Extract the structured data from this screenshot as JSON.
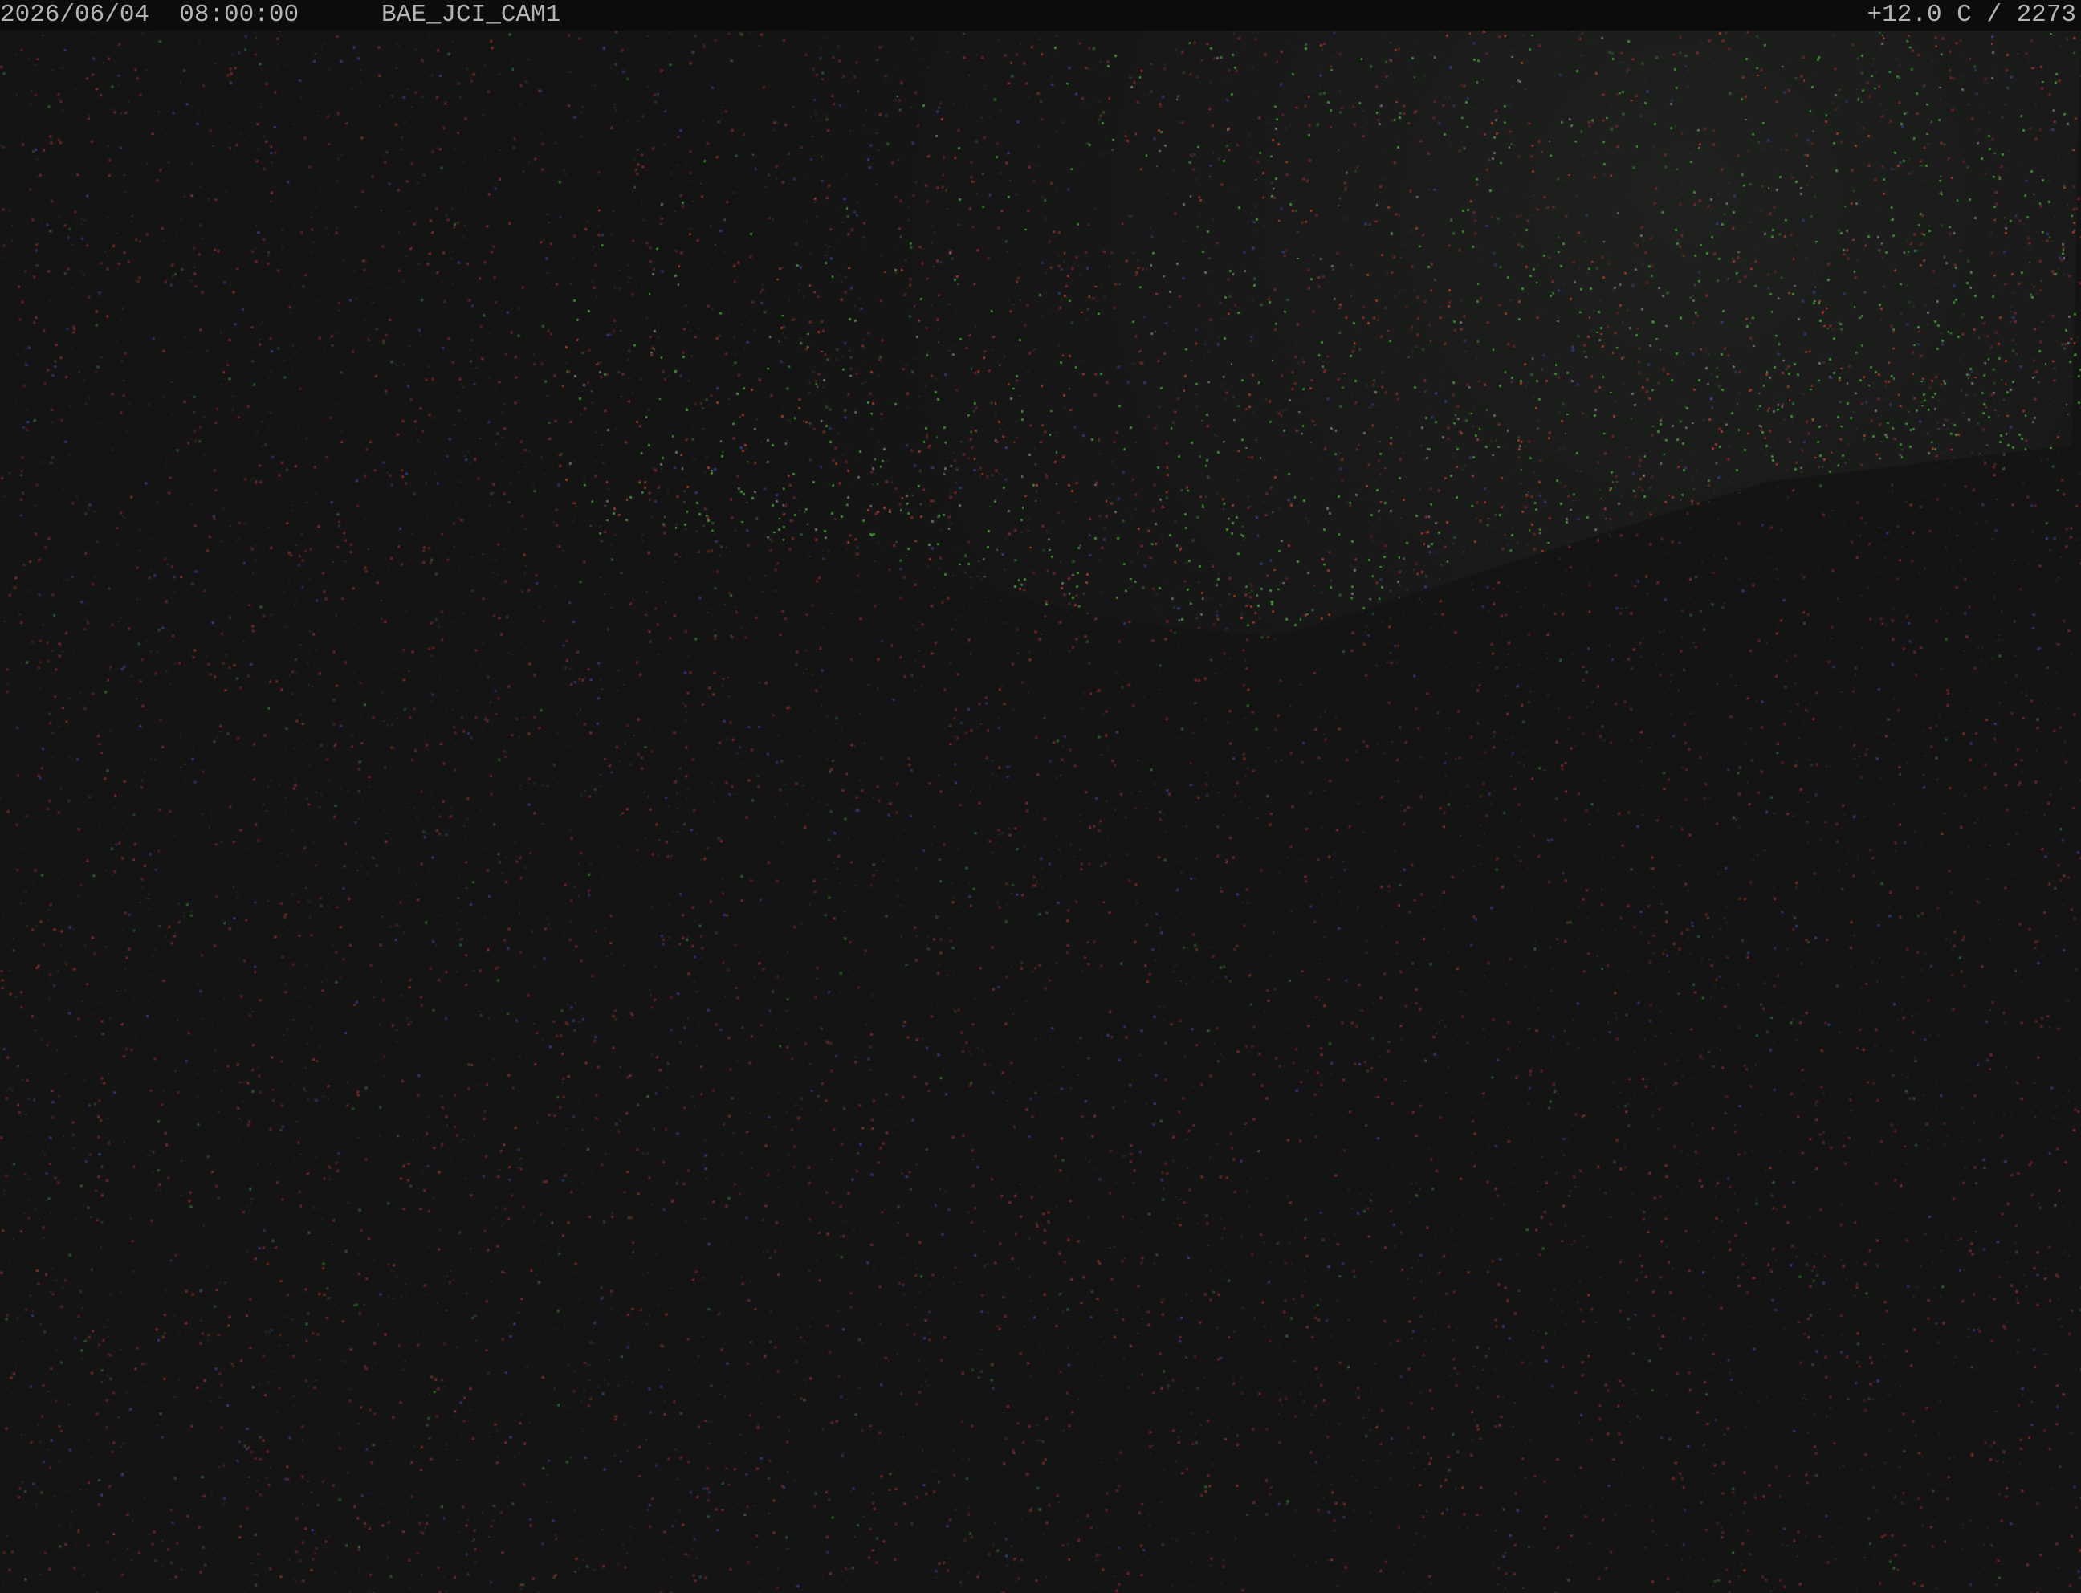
{
  "overlay": {
    "timestamp": "2026/06/04  08:00:00",
    "camera_id": "BAE_JCI_CAM1",
    "temperature_readout": "+12.0 C / 2273"
  },
  "colors": {
    "background": "#141414",
    "overlay_bar": "#0c0c0c",
    "overlay_text": "#b4b4b4",
    "noise_red": "#c03030",
    "noise_green": "#3aa03a",
    "noise_blue": "#3040c0"
  }
}
